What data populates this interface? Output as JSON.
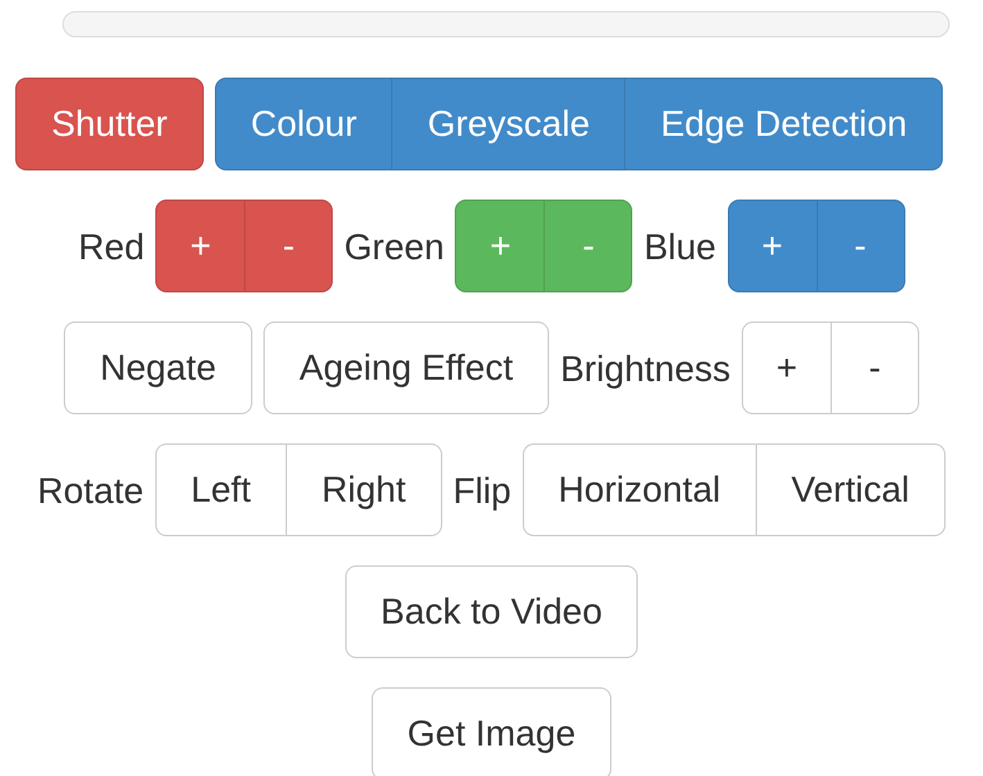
{
  "progress": {
    "level": 0
  },
  "rows": [
    {
      "items": [
        {
          "kind": "button",
          "color": "#d9534f",
          "label": "Shutter"
        },
        {
          "kind": "group",
          "color": "#428bca",
          "buttons": [
            "Colour",
            "Greyscale",
            "Edge Detection"
          ]
        }
      ]
    },
    {
      "items": [
        {
          "kind": "label",
          "label": "Red"
        },
        {
          "kind": "group",
          "color": "#d9534f",
          "buttons": [
            "+",
            "-"
          ]
        },
        {
          "kind": "label",
          "label": "Green"
        },
        {
          "kind": "group",
          "color": "#5cb85c",
          "buttons": [
            "+",
            "-"
          ]
        },
        {
          "kind": "label",
          "label": "Blue"
        },
        {
          "kind": "group",
          "color": "#428bca",
          "buttons": [
            "+",
            "-"
          ]
        }
      ]
    },
    {
      "items": [
        {
          "kind": "button",
          "color": "#ffffff",
          "label": "Negate"
        },
        {
          "kind": "button",
          "color": "#ffffff",
          "label": "Ageing Effect"
        },
        {
          "kind": "label",
          "label": "Brightness"
        },
        {
          "kind": "group",
          "color": "#ffffff",
          "buttons": [
            "+",
            "-"
          ]
        }
      ]
    },
    {
      "items": [
        {
          "kind": "label",
          "label": "Rotate"
        },
        {
          "kind": "group",
          "color": "#ffffff",
          "buttons": [
            "Left",
            "Right"
          ]
        },
        {
          "kind": "label",
          "label": "Flip"
        },
        {
          "kind": "group",
          "color": "#ffffff",
          "buttons": [
            "Horizontal",
            "Vertical"
          ]
        }
      ]
    },
    {
      "items": [
        {
          "kind": "button",
          "color": "#ffffff",
          "label": "Back to Video"
        }
      ]
    },
    {
      "items": [
        {
          "kind": "button",
          "color": "#ffffff",
          "label": "Get Image"
        }
      ]
    }
  ]
}
